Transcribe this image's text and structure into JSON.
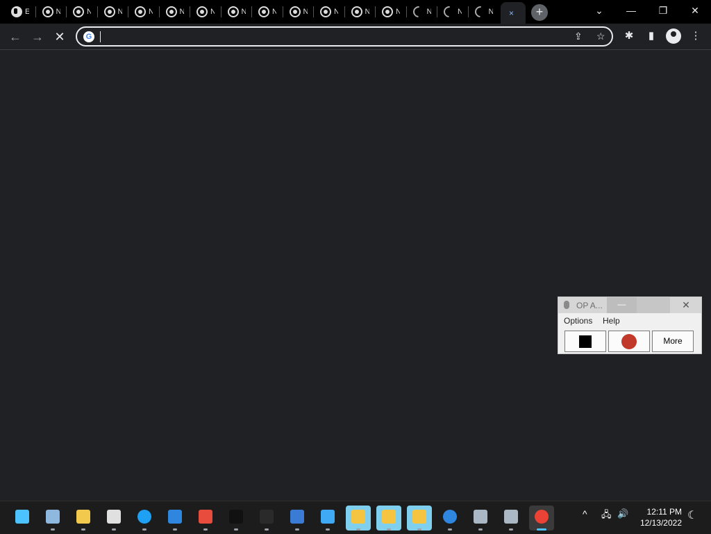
{
  "browser": {
    "tabs": [
      {
        "favicon": "globe-icon",
        "label": "E",
        "state": "loaded"
      },
      {
        "favicon": "chrome-icon",
        "label": "N",
        "state": "loaded"
      },
      {
        "favicon": "chrome-icon",
        "label": "N",
        "state": "loaded"
      },
      {
        "favicon": "chrome-icon",
        "label": "N",
        "state": "loaded"
      },
      {
        "favicon": "chrome-icon",
        "label": "N",
        "state": "loaded"
      },
      {
        "favicon": "chrome-icon",
        "label": "N",
        "state": "loaded"
      },
      {
        "favicon": "chrome-icon",
        "label": "N",
        "state": "loaded"
      },
      {
        "favicon": "chrome-icon",
        "label": "N",
        "state": "loaded"
      },
      {
        "favicon": "chrome-icon",
        "label": "N",
        "state": "loaded"
      },
      {
        "favicon": "chrome-icon",
        "label": "N",
        "state": "loaded"
      },
      {
        "favicon": "chrome-icon",
        "label": "N",
        "state": "loaded"
      },
      {
        "favicon": "chrome-icon",
        "label": "N",
        "state": "loaded"
      },
      {
        "favicon": "chrome-icon",
        "label": "N",
        "state": "loaded"
      },
      {
        "favicon": "loading-spinner-icon",
        "label": "N",
        "state": "loading"
      },
      {
        "favicon": "loading-spinner-icon",
        "label": "N",
        "state": "loading"
      },
      {
        "favicon": "loading-spinner-icon",
        "label": "N",
        "state": "loading"
      }
    ],
    "active_tab_close": "×",
    "new_tab_label": "+",
    "window_controls": {
      "tab_search": "⌄",
      "minimize": "—",
      "restore": "❐",
      "close": "✕"
    },
    "nav": {
      "back": "←",
      "forward": "→",
      "stop": "✕"
    },
    "omnibox": {
      "value": ""
    },
    "colors": {
      "background": "#202124",
      "tabstrip": "#000000",
      "accent": "#8ab4f8"
    }
  },
  "op_autoclicker": {
    "title": "OP A...",
    "minimize": "—",
    "close": "✕",
    "menu": {
      "options": "Options",
      "help": "Help"
    },
    "buttons": {
      "more": "More"
    }
  },
  "taskbar": {
    "apps": [
      {
        "name": "start-button",
        "color": "#4cc2ff"
      },
      {
        "name": "notepad",
        "color": "#8fb8de"
      },
      {
        "name": "file-explorer",
        "color": "#f2c94c"
      },
      {
        "name": "photo-viewer",
        "color": "#e0e0e0"
      },
      {
        "name": "edge",
        "color": "#1ea1f2"
      },
      {
        "name": "people",
        "color": "#2e86de"
      },
      {
        "name": "office",
        "color": "#e74c3c"
      },
      {
        "name": "terminal",
        "color": "#111111"
      },
      {
        "name": "blank-app",
        "color": "#2a2a2a"
      },
      {
        "name": "store",
        "color": "#3a7bd5"
      },
      {
        "name": "paint",
        "color": "#3fa9f5"
      },
      {
        "name": "defender-1",
        "color": "#f5c542"
      },
      {
        "name": "defender-2",
        "color": "#f5c542"
      },
      {
        "name": "defender-3",
        "color": "#f5c542"
      },
      {
        "name": "get-help",
        "color": "#2e86de"
      },
      {
        "name": "control-panel-1",
        "color": "#aab7c4"
      },
      {
        "name": "control-panel-2",
        "color": "#aab7c4"
      },
      {
        "name": "chrome",
        "color": "#ea4335"
      }
    ],
    "tray": {
      "chevron": "^",
      "network": "🖧",
      "volume": "🔊",
      "night": "☾"
    },
    "clock": {
      "time": "12:11 PM",
      "date": "12/13/2022"
    }
  }
}
